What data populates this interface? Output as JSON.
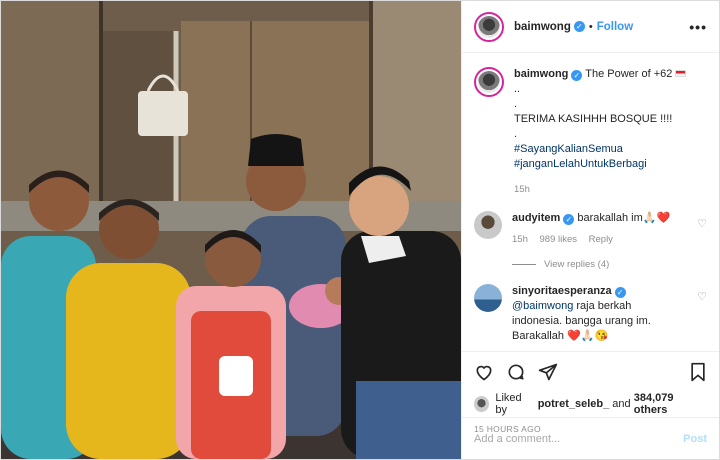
{
  "header": {
    "username": "baimwong",
    "follow_label": "Follow",
    "more_label": "•••"
  },
  "caption": {
    "username": "baimwong",
    "text_prefix": "The Power of +62",
    "text_suffix": "..",
    "line_dot1": ".",
    "line2": "TERIMA KASIHHH BOSQUE !!!!",
    "line_dot2": ".",
    "hashtag1": "#SayangKalianSemua",
    "hashtag2": "#janganLelahUntukBerbagi",
    "age": "15h"
  },
  "comments": [
    {
      "username": "audyitem",
      "text": "barakallah im",
      "emoji": "🙏🏻❤️",
      "age": "15h",
      "likes": "989 likes",
      "reply_label": "Reply",
      "view_replies": "View replies (4)"
    },
    {
      "username": "sinyoritaesperanza",
      "mention": "@baimwong",
      "text": "raja berkah indonesia. bangga urang im. Barakallah",
      "emoji": "❤️🙏🏻😘"
    }
  ],
  "actions": {
    "icons": [
      "heart-icon",
      "comment-icon",
      "share-icon",
      "bookmark-icon"
    ],
    "liked_by_prefix": "Liked by",
    "liked_by_user": "potret_seleb_",
    "liked_by_and": "and",
    "liked_by_count": "384,079 others",
    "timestamp": "15 HOURS AGO"
  },
  "add_comment": {
    "placeholder": "Add a comment...",
    "post_label": "Post"
  },
  "colors": {
    "accent": "#3897f0",
    "hashtag": "#003569",
    "muted": "#8e8e8e",
    "post_disabled": "#b2dffc"
  }
}
